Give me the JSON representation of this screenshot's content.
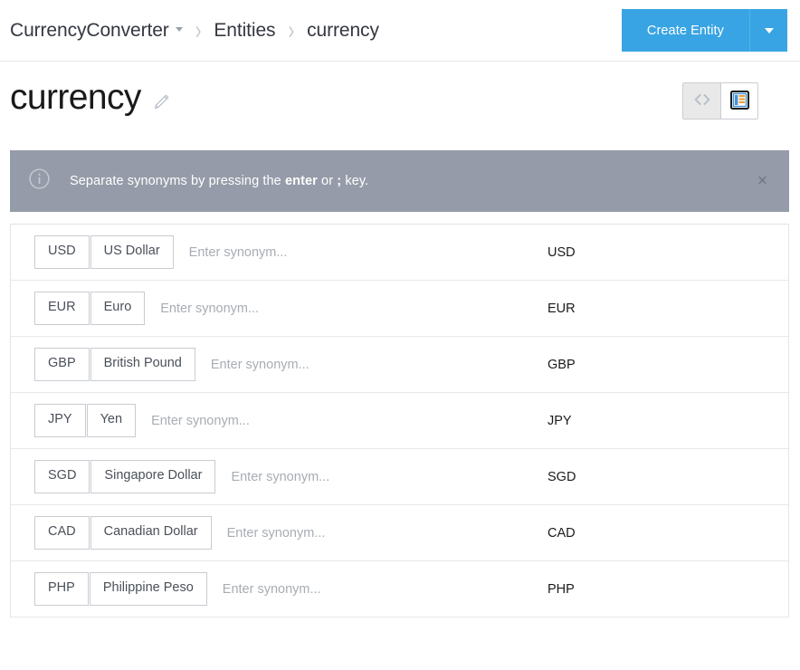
{
  "header": {
    "breadcrumb": {
      "app": "CurrencyConverter",
      "section": "Entities",
      "current": "currency",
      "separator": "›"
    },
    "create_button": {
      "label": "Create Entity",
      "dropdown_icon": "chevron-down-icon"
    }
  },
  "page": {
    "title": "currency",
    "edit_icon": "pencil-icon",
    "view_toggle": {
      "code_view_icon": "code-brackets-icon",
      "table_view_icon": "table-view-icon"
    }
  },
  "banner": {
    "icon": "info-circle-icon",
    "text_before": "Separate synonyms by pressing the ",
    "key_enter": "enter",
    "text_middle": " or ",
    "key_semicolon": ";",
    "text_after": " key.",
    "close_label": "×"
  },
  "table": {
    "synonym_placeholder": "Enter synonym...",
    "rows": [
      {
        "synonyms": [
          "USD",
          "US Dollar"
        ],
        "value": "USD"
      },
      {
        "synonyms": [
          "EUR",
          "Euro"
        ],
        "value": "EUR"
      },
      {
        "synonyms": [
          "GBP",
          "British Pound"
        ],
        "value": "GBP"
      },
      {
        "synonyms": [
          "JPY",
          "Yen"
        ],
        "value": "JPY"
      },
      {
        "synonyms": [
          "SGD",
          "Singapore Dollar"
        ],
        "value": "SGD"
      },
      {
        "synonyms": [
          "CAD",
          "Canadian Dollar"
        ],
        "value": "CAD"
      },
      {
        "synonyms": [
          "PHP",
          "Philippine Peso"
        ],
        "value": "PHP"
      }
    ]
  },
  "colors": {
    "accent": "#38a4e3",
    "banner_bg": "#959ba8",
    "border": "#e2e4e7",
    "text": "#343741"
  }
}
